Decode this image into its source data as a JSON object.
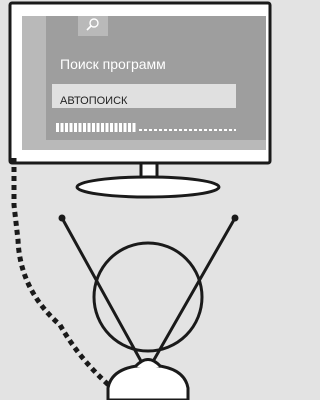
{
  "screen": {
    "title": "Поиск программ",
    "field_value": "АВТОПОИСК",
    "progress": 0.45
  },
  "icons": {
    "search": "search-icon"
  },
  "colors": {
    "page_background": "#e3e3e3",
    "tv_frame": "#ffffff",
    "outline": "#1a1a1a",
    "screen": "#b9b9b9",
    "panel": "#9e9e9e",
    "field": "#e0e0e0"
  }
}
